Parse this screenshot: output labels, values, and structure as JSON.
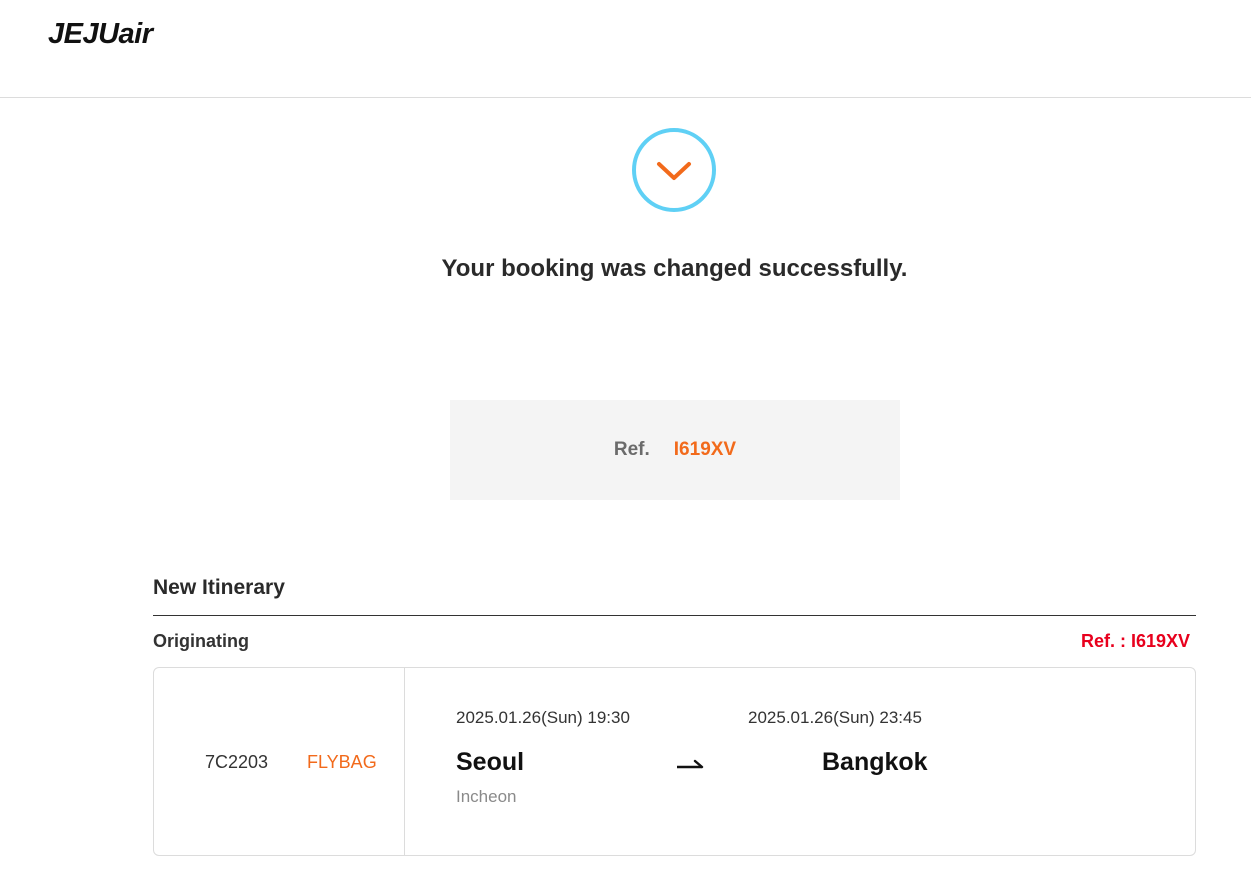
{
  "header": {
    "logo_text": "JEJUair"
  },
  "confirmation": {
    "icon": "check-circle-icon",
    "title": "Your booking was changed successfully.",
    "ref_label": "Ref.",
    "ref_code": "I619XV"
  },
  "itinerary": {
    "section_title": "New Itinerary",
    "leg_label": "Originating",
    "leg_ref": "Ref. : I619XV",
    "flight": {
      "flight_number": "7C2203",
      "fare_type": "FLYBAG",
      "departure_datetime": "2025.01.26(Sun) 19:30",
      "arrival_datetime": "2025.01.26(Sun) 23:45",
      "departure_city": "Seoul",
      "departure_airport": "Incheon",
      "arrival_city": "Bangkok",
      "direction_icon": "arrow-right-icon"
    }
  },
  "colors": {
    "accent_orange": "#f26a1b",
    "ref_red": "#e8001d",
    "check_ring": "#5fd0f5"
  }
}
